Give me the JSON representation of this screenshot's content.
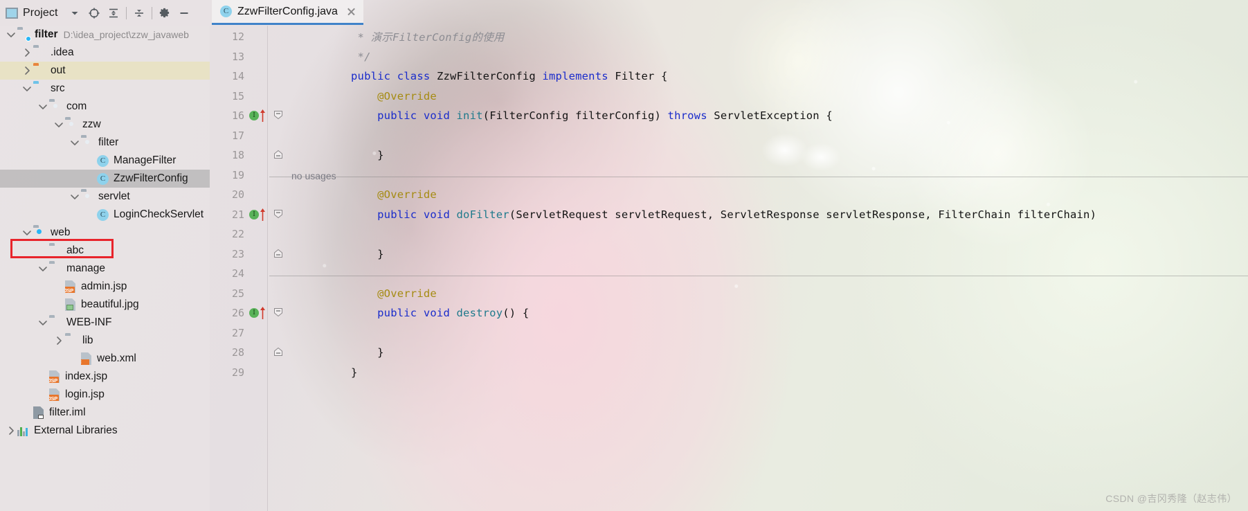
{
  "tool_window": {
    "title": "Project",
    "title_icon": "project-window-icon",
    "toolbar": [
      {
        "name": "view-mode-dropdown-icon",
        "glyph": "chevron-down-icon"
      },
      {
        "name": "select-opened-file-icon",
        "glyph": "target-icon"
      },
      {
        "name": "expand-all-icon",
        "glyph": "expand-all-icon"
      },
      {
        "name": "collapse-all-icon",
        "glyph": "collapse-all-icon"
      },
      {
        "name": "settings-gear-icon",
        "glyph": "gear-icon"
      },
      {
        "name": "hide-tool-window-icon",
        "glyph": "minimize-icon"
      }
    ]
  },
  "tree": {
    "items": [
      {
        "label": "filter",
        "path": "D:\\idea_project\\zzw_javaweb",
        "indent": 0,
        "arrow": "down",
        "icon": "folder-module",
        "bold": true
      },
      {
        "label": ".idea",
        "path": "",
        "indent": 1,
        "arrow": "right",
        "icon": "folder-grey",
        "bold": false
      },
      {
        "label": "out",
        "path": "",
        "indent": 1,
        "arrow": "right",
        "icon": "folder-orange",
        "bold": false,
        "highlight": "out"
      },
      {
        "label": "src",
        "path": "",
        "indent": 1,
        "arrow": "down",
        "icon": "folder-blue",
        "bold": false
      },
      {
        "label": "com",
        "path": "",
        "indent": 2,
        "arrow": "down",
        "icon": "folder-package",
        "bold": false
      },
      {
        "label": "zzw",
        "path": "",
        "indent": 3,
        "arrow": "down",
        "icon": "folder-package",
        "bold": false
      },
      {
        "label": "filter",
        "path": "",
        "indent": 4,
        "arrow": "down",
        "icon": "folder-package",
        "bold": false
      },
      {
        "label": "ManageFilter",
        "path": "",
        "indent": 5,
        "arrow": "none",
        "icon": "java-class",
        "bold": false
      },
      {
        "label": "ZzwFilterConfig",
        "path": "",
        "indent": 5,
        "arrow": "none",
        "icon": "java-class",
        "bold": false,
        "selected": true
      },
      {
        "label": "servlet",
        "path": "",
        "indent": 4,
        "arrow": "down",
        "icon": "folder-package",
        "bold": false
      },
      {
        "label": "LoginCheckServlet",
        "path": "",
        "indent": 5,
        "arrow": "none",
        "icon": "java-class",
        "bold": false
      },
      {
        "label": "web",
        "path": "",
        "indent": 1,
        "arrow": "down",
        "icon": "folder-web",
        "bold": false
      },
      {
        "label": "abc",
        "path": "",
        "indent": 2,
        "arrow": "none",
        "icon": "folder-plain",
        "bold": false,
        "annotated": true
      },
      {
        "label": "manage",
        "path": "",
        "indent": 2,
        "arrow": "down",
        "icon": "folder-plain",
        "bold": false
      },
      {
        "label": "admin.jsp",
        "path": "",
        "indent": 3,
        "arrow": "none",
        "icon": "file-jsp",
        "bold": false
      },
      {
        "label": "beautiful.jpg",
        "path": "",
        "indent": 3,
        "arrow": "none",
        "icon": "file-image",
        "bold": false
      },
      {
        "label": "WEB-INF",
        "path": "",
        "indent": 2,
        "arrow": "down",
        "icon": "folder-plain",
        "bold": false
      },
      {
        "label": "lib",
        "path": "",
        "indent": 3,
        "arrow": "right",
        "icon": "folder-plain",
        "bold": false
      },
      {
        "label": "web.xml",
        "path": "",
        "indent": 4,
        "arrow": "none",
        "icon": "file-xml",
        "bold": false
      },
      {
        "label": "index.jsp",
        "path": "",
        "indent": 2,
        "arrow": "none",
        "icon": "file-jsp",
        "bold": false
      },
      {
        "label": "login.jsp",
        "path": "",
        "indent": 2,
        "arrow": "none",
        "icon": "file-jsp",
        "bold": false
      },
      {
        "label": "filter.iml",
        "path": "",
        "indent": 1,
        "arrow": "none",
        "icon": "file-iml",
        "bold": false
      },
      {
        "label": "External Libraries",
        "path": "",
        "indent": 0,
        "arrow": "right",
        "icon": "external-libraries",
        "bold": false
      }
    ]
  },
  "editor": {
    "tab": {
      "label": "ZzwFilterConfig.java",
      "icon": "java-class-icon",
      "close_icon": "close-icon",
      "active": true
    },
    "first_line_number": 12,
    "hints": [
      {
        "text": "no usages",
        "line": 20
      }
    ],
    "lines": [
      {
        "num": 12,
        "indent": 0,
        "tokens": [
          {
            "t": " * 演示FilterConfig的使用",
            "c": "cmt"
          }
        ],
        "gutter": ""
      },
      {
        "num": 13,
        "indent": 0,
        "tokens": [
          {
            "t": " */",
            "c": "cmt"
          }
        ],
        "gutter": ""
      },
      {
        "num": 14,
        "indent": 0,
        "tokens": [
          {
            "t": "public ",
            "c": "kw"
          },
          {
            "t": "class ",
            "c": "kw"
          },
          {
            "t": "ZzwFilterConfig ",
            "c": "plain"
          },
          {
            "t": "implements ",
            "c": "kw"
          },
          {
            "t": "Filter {",
            "c": "plain"
          }
        ],
        "gutter": ""
      },
      {
        "num": 15,
        "indent": 0,
        "tokens": [
          {
            "t": "    @Override",
            "c": "ann"
          }
        ],
        "gutter": ""
      },
      {
        "num": 16,
        "indent": 0,
        "tokens": [
          {
            "t": "    public void ",
            "c": "kw"
          },
          {
            "t": "init",
            "c": "cls2"
          },
          {
            "t": "(FilterConfig filterConfig) ",
            "c": "plain"
          },
          {
            "t": "throws ",
            "c": "kw"
          },
          {
            "t": "ServletException {",
            "c": "plain"
          }
        ],
        "gutter": "run"
      },
      {
        "num": 17,
        "indent": 0,
        "tokens": [],
        "gutter": ""
      },
      {
        "num": 18,
        "indent": 0,
        "tokens": [
          {
            "t": "    }",
            "c": "plain"
          }
        ],
        "gutter": "fold-end"
      },
      {
        "num": 19,
        "indent": 0,
        "tokens": [],
        "gutter": ""
      },
      {
        "num": 20,
        "indent": 0,
        "tokens": [
          {
            "t": "    @Override",
            "c": "ann"
          }
        ],
        "gutter": ""
      },
      {
        "num": 21,
        "indent": 0,
        "tokens": [
          {
            "t": "    public void ",
            "c": "kw"
          },
          {
            "t": "doFilter",
            "c": "cls2"
          },
          {
            "t": "(ServletRequest servletRequest, ServletResponse servletResponse, FilterChain filterChain)",
            "c": "plain"
          }
        ],
        "gutter": "run"
      },
      {
        "num": 22,
        "indent": 0,
        "tokens": [],
        "gutter": ""
      },
      {
        "num": 23,
        "indent": 0,
        "tokens": [
          {
            "t": "    }",
            "c": "plain"
          }
        ],
        "gutter": "fold-end"
      },
      {
        "num": 24,
        "indent": 0,
        "tokens": [],
        "gutter": ""
      },
      {
        "num": 25,
        "indent": 0,
        "tokens": [
          {
            "t": "    @Override",
            "c": "ann"
          }
        ],
        "gutter": ""
      },
      {
        "num": 26,
        "indent": 0,
        "tokens": [
          {
            "t": "    public void ",
            "c": "kw"
          },
          {
            "t": "destroy",
            "c": "cls2"
          },
          {
            "t": "() {",
            "c": "plain"
          }
        ],
        "gutter": "run"
      },
      {
        "num": 27,
        "indent": 0,
        "tokens": [],
        "gutter": ""
      },
      {
        "num": 28,
        "indent": 0,
        "tokens": [
          {
            "t": "    }",
            "c": "plain"
          }
        ],
        "gutter": "fold-end"
      },
      {
        "num": 29,
        "indent": 0,
        "tokens": [
          {
            "t": "}",
            "c": "plain"
          }
        ],
        "gutter": ""
      }
    ]
  },
  "watermark": {
    "text": "CSDN @吉冈秀隆（赵志伟）"
  },
  "colors": {
    "accent_tab_underline": "#4083c9",
    "annotation_red": "#e8242b",
    "selection_grey": "#aaaaaa",
    "keyword_blue": "#1a2ccb",
    "method_teal": "#1f7a8c",
    "annotation_yellow": "#a58b12",
    "comment_grey": "#8d8d93",
    "folder_blue": "#6ec2e8",
    "folder_orange": "#e8843c",
    "run_marker_green": "#59b259"
  }
}
